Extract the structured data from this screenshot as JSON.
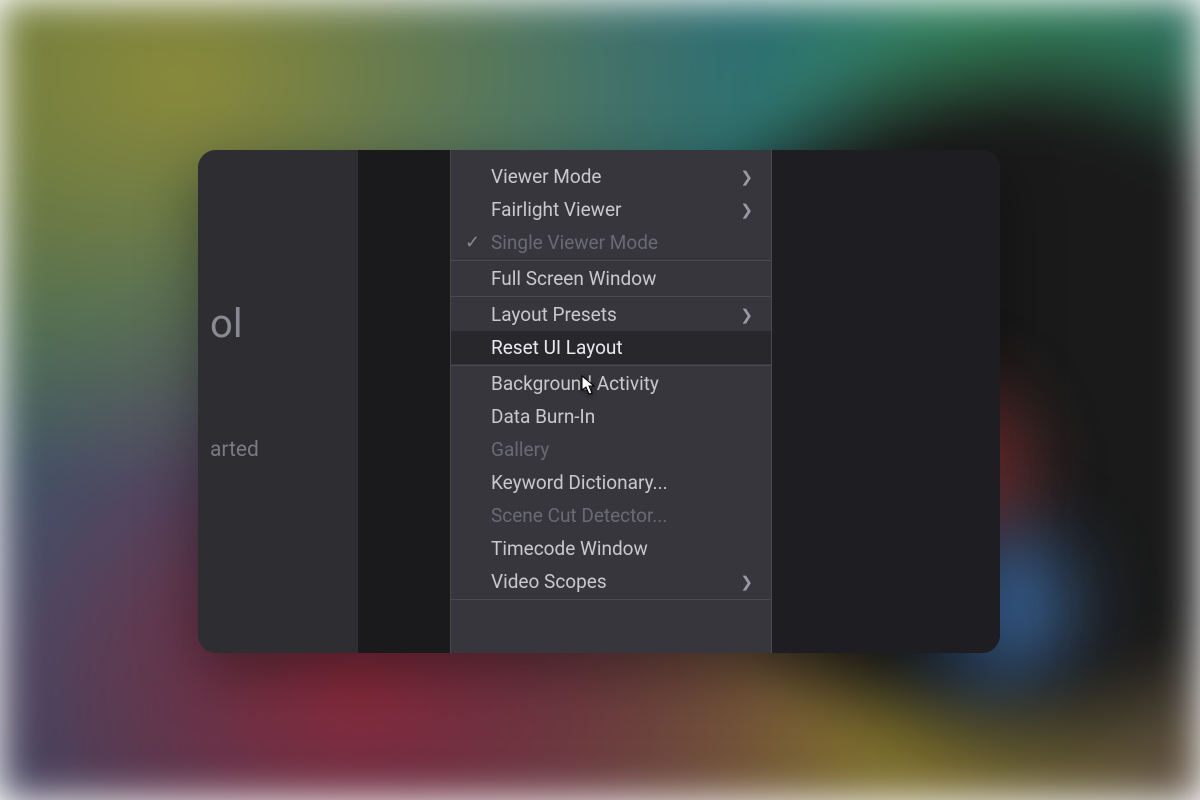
{
  "background_partial_text_1": "ol",
  "background_partial_text_2": "arted",
  "menu": {
    "sections": [
      {
        "items": [
          {
            "label": "Viewer Mode",
            "has_submenu": true,
            "disabled": false,
            "checked": false,
            "highlighted": false
          },
          {
            "label": "Fairlight Viewer",
            "has_submenu": true,
            "disabled": false,
            "checked": false,
            "highlighted": false
          },
          {
            "label": "Single Viewer Mode",
            "has_submenu": false,
            "disabled": true,
            "checked": true,
            "highlighted": false
          }
        ]
      },
      {
        "items": [
          {
            "label": "Full Screen Window",
            "has_submenu": false,
            "disabled": false,
            "checked": false,
            "highlighted": false
          }
        ]
      },
      {
        "items": [
          {
            "label": "Layout Presets",
            "has_submenu": true,
            "disabled": false,
            "checked": false,
            "highlighted": false
          },
          {
            "label": "Reset UI Layout",
            "has_submenu": false,
            "disabled": false,
            "checked": false,
            "highlighted": true
          }
        ]
      },
      {
        "items": [
          {
            "label": "Background Activity",
            "has_submenu": false,
            "disabled": false,
            "checked": false,
            "highlighted": false
          },
          {
            "label": "Data Burn-In",
            "has_submenu": false,
            "disabled": false,
            "checked": false,
            "highlighted": false
          },
          {
            "label": "Gallery",
            "has_submenu": false,
            "disabled": true,
            "checked": false,
            "highlighted": false
          },
          {
            "label": "Keyword Dictionary...",
            "has_submenu": false,
            "disabled": false,
            "checked": false,
            "highlighted": false
          },
          {
            "label": "Scene Cut Detector...",
            "has_submenu": false,
            "disabled": true,
            "checked": false,
            "highlighted": false
          },
          {
            "label": "Timecode Window",
            "has_submenu": false,
            "disabled": false,
            "checked": false,
            "highlighted": false
          },
          {
            "label": "Video Scopes",
            "has_submenu": true,
            "disabled": false,
            "checked": false,
            "highlighted": false
          }
        ]
      }
    ]
  }
}
